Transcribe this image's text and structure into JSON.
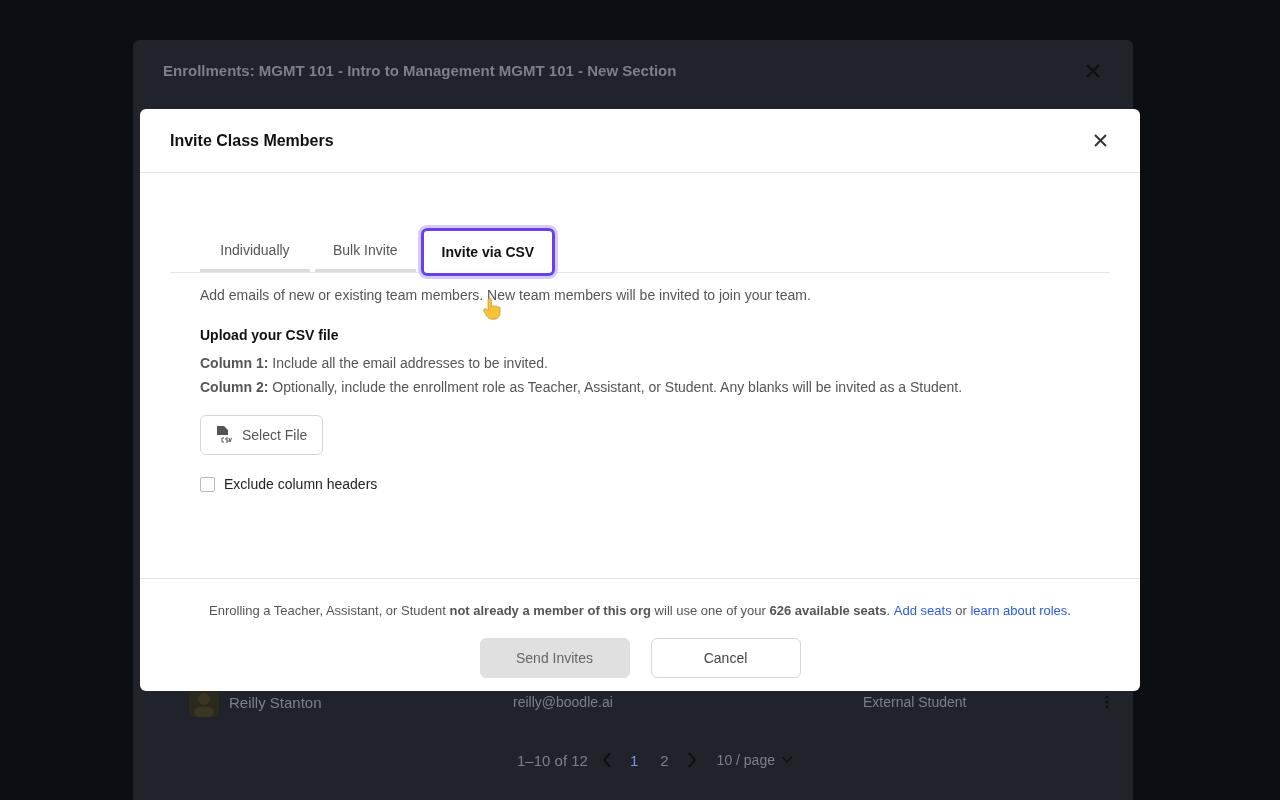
{
  "background_dialog": {
    "title": "Enrollments: MGMT 101 - Intro to Management MGMT 101 - New Section",
    "row": {
      "name": "Reilly Stanton",
      "email": "reilly@boodle.ai",
      "role": "External Student"
    },
    "pagination": {
      "range": "1–10 of 12",
      "pages": [
        {
          "label": "1",
          "selected": true
        },
        {
          "label": "2",
          "selected": false
        }
      ],
      "page_size": "10 / page"
    }
  },
  "dialog": {
    "title": "Invite Class Members",
    "tabs": [
      {
        "label": "Individually",
        "selected": false
      },
      {
        "label": "Bulk Invite",
        "selected": false
      },
      {
        "label": "Invite via CSV",
        "selected": true
      }
    ],
    "description": "Add emails of new or existing team members. New team members will be invited to join your team.",
    "upload_heading": "Upload your CSV file",
    "columns": [
      "**Column 1:** Include all the email addresses to be invited.",
      "**Column 2:** Optionally, include the enrollment role as Teacher, Assistant, or Student. Any blanks will be invited as a Student."
    ],
    "select_file": "Select File",
    "exclude_headers": {
      "label": "Exclude column headers",
      "checked": false
    },
    "seat_notice": {
      "text": "Enrolling a Teacher, Assistant, or Student **not already a member of this org** will use one of your **626 available seats**.",
      "add_seats": "Add seats",
      "joiner": "or",
      "learn": "learn about roles",
      "end": "."
    },
    "buttons": [
      {
        "label": "Send Invites",
        "disabled": true
      },
      {
        "label": "Cancel",
        "disabled": false
      }
    ]
  }
}
